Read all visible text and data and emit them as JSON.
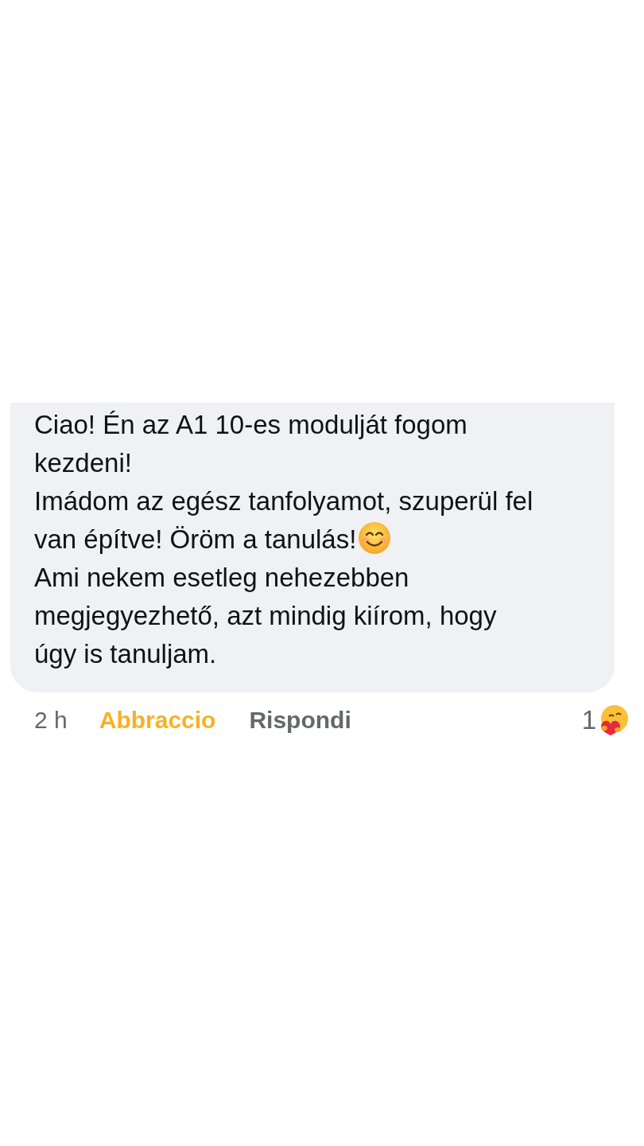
{
  "comment": {
    "lines": [
      {
        "text": "Ciao! Én az A1 10-es modulját fogom",
        "emoji": false
      },
      {
        "text": "kezdeni!",
        "emoji": false
      },
      {
        "text": "Imádom az egész tanfolyamot, szuperül fel",
        "emoji": false
      },
      {
        "text": "van építve! Öröm a tanulás!",
        "emoji": true
      },
      {
        "text": "Ami nekem esetleg nehezebben",
        "emoji": false
      },
      {
        "text": "megjegyezhető, azt mindig kiírom, hogy",
        "emoji": false
      },
      {
        "text": "úgy is tanuljam.",
        "emoji": false
      }
    ],
    "time": "2 h",
    "reaction": {
      "label": "Abbraccio",
      "selected": true
    },
    "reply": "Rispondi",
    "reaction_count": "1"
  }
}
